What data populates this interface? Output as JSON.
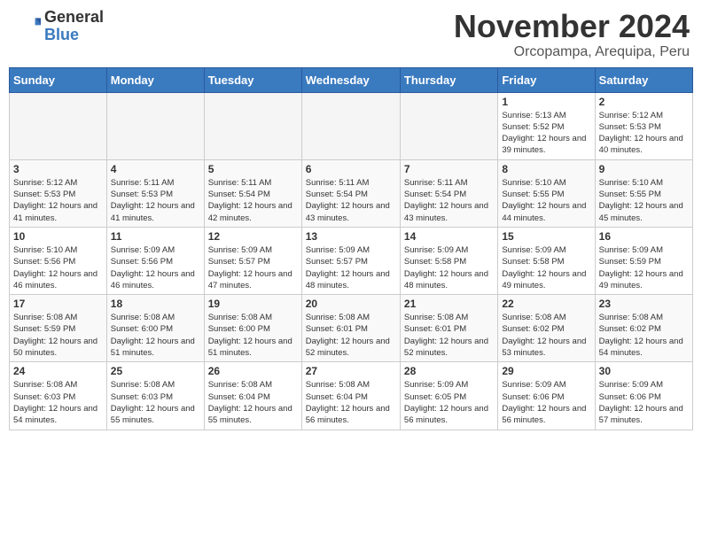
{
  "header": {
    "logo_general": "General",
    "logo_blue": "Blue",
    "month_title": "November 2024",
    "location": "Orcopampa, Arequipa, Peru"
  },
  "days_of_week": [
    "Sunday",
    "Monday",
    "Tuesday",
    "Wednesday",
    "Thursday",
    "Friday",
    "Saturday"
  ],
  "weeks": [
    [
      {
        "day": "",
        "info": ""
      },
      {
        "day": "",
        "info": ""
      },
      {
        "day": "",
        "info": ""
      },
      {
        "day": "",
        "info": ""
      },
      {
        "day": "",
        "info": ""
      },
      {
        "day": "1",
        "info": "Sunrise: 5:13 AM\nSunset: 5:52 PM\nDaylight: 12 hours and 39 minutes."
      },
      {
        "day": "2",
        "info": "Sunrise: 5:12 AM\nSunset: 5:53 PM\nDaylight: 12 hours and 40 minutes."
      }
    ],
    [
      {
        "day": "3",
        "info": "Sunrise: 5:12 AM\nSunset: 5:53 PM\nDaylight: 12 hours and 41 minutes."
      },
      {
        "day": "4",
        "info": "Sunrise: 5:11 AM\nSunset: 5:53 PM\nDaylight: 12 hours and 41 minutes."
      },
      {
        "day": "5",
        "info": "Sunrise: 5:11 AM\nSunset: 5:54 PM\nDaylight: 12 hours and 42 minutes."
      },
      {
        "day": "6",
        "info": "Sunrise: 5:11 AM\nSunset: 5:54 PM\nDaylight: 12 hours and 43 minutes."
      },
      {
        "day": "7",
        "info": "Sunrise: 5:11 AM\nSunset: 5:54 PM\nDaylight: 12 hours and 43 minutes."
      },
      {
        "day": "8",
        "info": "Sunrise: 5:10 AM\nSunset: 5:55 PM\nDaylight: 12 hours and 44 minutes."
      },
      {
        "day": "9",
        "info": "Sunrise: 5:10 AM\nSunset: 5:55 PM\nDaylight: 12 hours and 45 minutes."
      }
    ],
    [
      {
        "day": "10",
        "info": "Sunrise: 5:10 AM\nSunset: 5:56 PM\nDaylight: 12 hours and 46 minutes."
      },
      {
        "day": "11",
        "info": "Sunrise: 5:09 AM\nSunset: 5:56 PM\nDaylight: 12 hours and 46 minutes."
      },
      {
        "day": "12",
        "info": "Sunrise: 5:09 AM\nSunset: 5:57 PM\nDaylight: 12 hours and 47 minutes."
      },
      {
        "day": "13",
        "info": "Sunrise: 5:09 AM\nSunset: 5:57 PM\nDaylight: 12 hours and 48 minutes."
      },
      {
        "day": "14",
        "info": "Sunrise: 5:09 AM\nSunset: 5:58 PM\nDaylight: 12 hours and 48 minutes."
      },
      {
        "day": "15",
        "info": "Sunrise: 5:09 AM\nSunset: 5:58 PM\nDaylight: 12 hours and 49 minutes."
      },
      {
        "day": "16",
        "info": "Sunrise: 5:09 AM\nSunset: 5:59 PM\nDaylight: 12 hours and 49 minutes."
      }
    ],
    [
      {
        "day": "17",
        "info": "Sunrise: 5:08 AM\nSunset: 5:59 PM\nDaylight: 12 hours and 50 minutes."
      },
      {
        "day": "18",
        "info": "Sunrise: 5:08 AM\nSunset: 6:00 PM\nDaylight: 12 hours and 51 minutes."
      },
      {
        "day": "19",
        "info": "Sunrise: 5:08 AM\nSunset: 6:00 PM\nDaylight: 12 hours and 51 minutes."
      },
      {
        "day": "20",
        "info": "Sunrise: 5:08 AM\nSunset: 6:01 PM\nDaylight: 12 hours and 52 minutes."
      },
      {
        "day": "21",
        "info": "Sunrise: 5:08 AM\nSunset: 6:01 PM\nDaylight: 12 hours and 52 minutes."
      },
      {
        "day": "22",
        "info": "Sunrise: 5:08 AM\nSunset: 6:02 PM\nDaylight: 12 hours and 53 minutes."
      },
      {
        "day": "23",
        "info": "Sunrise: 5:08 AM\nSunset: 6:02 PM\nDaylight: 12 hours and 54 minutes."
      }
    ],
    [
      {
        "day": "24",
        "info": "Sunrise: 5:08 AM\nSunset: 6:03 PM\nDaylight: 12 hours and 54 minutes."
      },
      {
        "day": "25",
        "info": "Sunrise: 5:08 AM\nSunset: 6:03 PM\nDaylight: 12 hours and 55 minutes."
      },
      {
        "day": "26",
        "info": "Sunrise: 5:08 AM\nSunset: 6:04 PM\nDaylight: 12 hours and 55 minutes."
      },
      {
        "day": "27",
        "info": "Sunrise: 5:08 AM\nSunset: 6:04 PM\nDaylight: 12 hours and 56 minutes."
      },
      {
        "day": "28",
        "info": "Sunrise: 5:09 AM\nSunset: 6:05 PM\nDaylight: 12 hours and 56 minutes."
      },
      {
        "day": "29",
        "info": "Sunrise: 5:09 AM\nSunset: 6:06 PM\nDaylight: 12 hours and 56 minutes."
      },
      {
        "day": "30",
        "info": "Sunrise: 5:09 AM\nSunset: 6:06 PM\nDaylight: 12 hours and 57 minutes."
      }
    ]
  ]
}
